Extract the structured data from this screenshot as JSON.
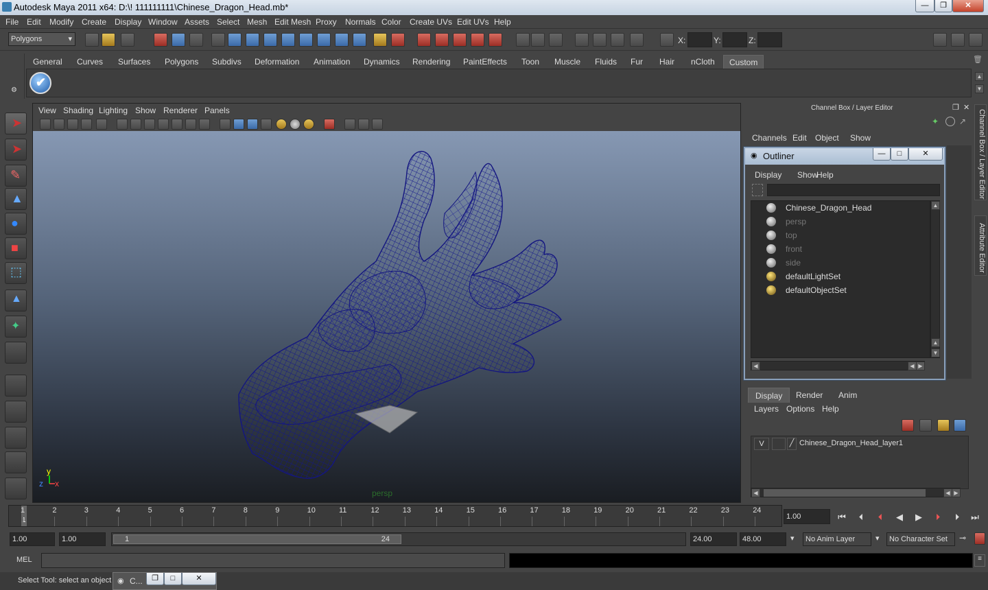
{
  "window": {
    "title": "Autodesk Maya 2011 x64: D:\\! 111111111\\Chinese_Dragon_Head.mb*",
    "minimize": "—",
    "maximize": "❐",
    "close": "✕"
  },
  "menubar": [
    "File",
    "Edit",
    "Modify",
    "Create",
    "Display",
    "Window",
    "Assets",
    "Select",
    "Mesh",
    "Edit Mesh",
    "Proxy",
    "Normals",
    "Color",
    "Create UVs",
    "Edit UVs",
    "Help"
  ],
  "statusline": {
    "mode": "Polygons",
    "x_label": "X:",
    "y_label": "Y:",
    "z_label": "Z:"
  },
  "shelf_tabs": [
    "General",
    "Curves",
    "Surfaces",
    "Polygons",
    "Subdivs",
    "Deformation",
    "Animation",
    "Dynamics",
    "Rendering",
    "PaintEffects",
    "Toon",
    "Muscle",
    "Fluids",
    "Fur",
    "Hair",
    "nCloth",
    "Custom"
  ],
  "shelf_active_tab": "Custom",
  "viewport": {
    "menus": [
      "View",
      "Shading",
      "Lighting",
      "Show",
      "Renderer",
      "Panels"
    ],
    "camera_label": "persp",
    "axis_y": "y",
    "axis_x": "x",
    "axis_z": "z"
  },
  "channel_box": {
    "title": "Channel Box / Layer Editor",
    "menus": [
      "Channels",
      "Edit",
      "Object",
      "Show"
    ]
  },
  "outliner": {
    "title": "Outliner",
    "menus": [
      "Display",
      "Show",
      "Help"
    ],
    "items": [
      {
        "label": "Chinese_Dragon_Head",
        "dim": false
      },
      {
        "label": "persp",
        "dim": true
      },
      {
        "label": "top",
        "dim": true
      },
      {
        "label": "front",
        "dim": true
      },
      {
        "label": "side",
        "dim": true
      },
      {
        "label": "defaultLightSet",
        "dim": false
      },
      {
        "label": "defaultObjectSet",
        "dim": false
      }
    ]
  },
  "layer_editor": {
    "tabs": [
      "Display",
      "Render",
      "Anim"
    ],
    "active_tab": "Display",
    "menus": [
      "Layers",
      "Options",
      "Help"
    ],
    "layer_visibility": "V",
    "layer_name": "Chinese_Dragon_Head_layer1"
  },
  "side_tabs": [
    "Channel Box / Layer Editor",
    "Attribute Editor"
  ],
  "timeslider": {
    "ticks": [
      "1",
      "2",
      "3",
      "4",
      "5",
      "6",
      "7",
      "8",
      "9",
      "10",
      "11",
      "12",
      "13",
      "14",
      "15",
      "16",
      "17",
      "18",
      "19",
      "20",
      "21",
      "22",
      "23",
      "24"
    ],
    "current_frame_marker": "1",
    "current_time": "1.00"
  },
  "range": {
    "start": "1.00",
    "playback_start": "1.00",
    "slider_min": "1",
    "slider_max": "24",
    "playback_end": "24.00",
    "end": "48.00",
    "anim_layer": "No Anim Layer",
    "character_set": "No Character Set"
  },
  "cmdline": {
    "label": "MEL"
  },
  "helpline": {
    "text": "Select Tool: select an object",
    "mini_window_title": "C..."
  },
  "playback": [
    "⏮",
    "⏭",
    "⏪",
    "◀",
    "▶",
    "⏩",
    "⏭",
    "⏭"
  ]
}
